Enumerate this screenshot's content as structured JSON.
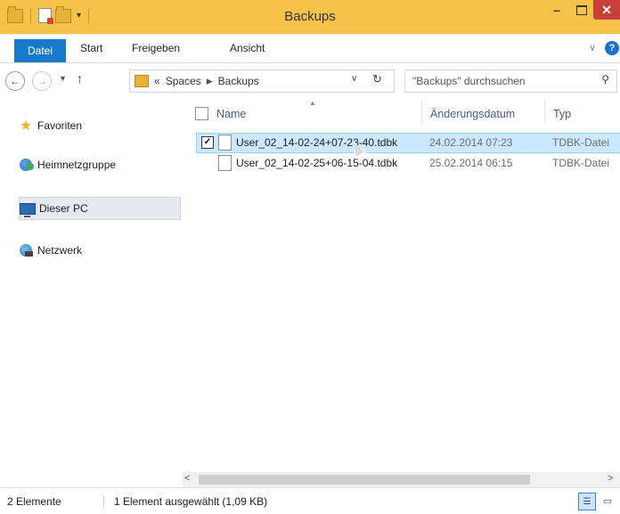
{
  "window": {
    "title": "Backups"
  },
  "ribbon": {
    "tabs": [
      "Datei",
      "Start",
      "Freigeben",
      "Ansicht"
    ]
  },
  "address": {
    "overflow": "«",
    "crumbs": [
      "Spaces",
      "Backups"
    ]
  },
  "search": {
    "placeholder": "\"Backups\" durchsuchen"
  },
  "navigation": {
    "items": [
      "Favoriten",
      "Heimnetzgruppe",
      "Dieser PC",
      "Netzwerk"
    ],
    "selected": "Dieser PC"
  },
  "columns": {
    "name": "Name",
    "date": "Änderungsdatum",
    "type": "Typ"
  },
  "files": [
    {
      "name": "User_02_14-02-24+07-23-40.tdbk",
      "date": "24.02.2014 07:23",
      "type": "TDBK-Datei",
      "selected": true,
      "checked": true
    },
    {
      "name": "User_02_14-02-25+06-15-04.tdbk",
      "date": "25.02.2014 06:15",
      "type": "TDBK-Datei",
      "selected": false,
      "checked": false
    }
  ],
  "status": {
    "count": "2 Elemente",
    "selection": "1 Element ausgewählt (1,09 KB)"
  },
  "icons": {
    "nav_favorites": "star-icon",
    "nav_homegroup": "homegroup-icon",
    "nav_pc": "computer-icon",
    "nav_network": "network-icon",
    "file": "file-icon"
  },
  "colors": {
    "titlebar": "#f5c24a",
    "accent": "#1979ca",
    "close": "#c7403a",
    "selection": "#cce8ff"
  }
}
